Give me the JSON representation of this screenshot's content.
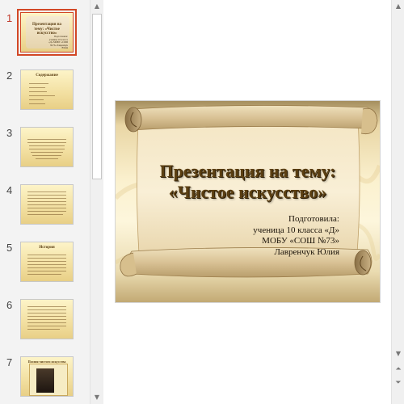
{
  "thumbnails": [
    {
      "number": "1",
      "title": "Презентация на тему: «Чистое искусство»",
      "author_small": "Подготовила: ученица 10 класса «Д» МОБУ «СОШ №73» Лавренчук Юлия"
    },
    {
      "number": "2",
      "heading": "Содержание"
    },
    {
      "number": "3"
    },
    {
      "number": "4"
    },
    {
      "number": "5",
      "heading": "История"
    },
    {
      "number": "6"
    },
    {
      "number": "7",
      "heading": "Поэзия чистого искусства"
    }
  ],
  "slide": {
    "title_line1": "Презентация на тему:",
    "title_line2": "«Чистое искусство»",
    "author": [
      "Подготовила:",
      "ученица 10 класса «Д»",
      "МОБУ «СОШ №73»",
      "Лавренчук Юлия"
    ]
  },
  "colors": {
    "accent": "#d24726",
    "title_text": "#5b3f12",
    "parchment": "#f5ead1"
  },
  "icons": {
    "scroll_up": "triangle-up",
    "scroll_down": "triangle-down",
    "prev_slide": "double-chevron-up",
    "next_slide": "double-chevron-down"
  }
}
